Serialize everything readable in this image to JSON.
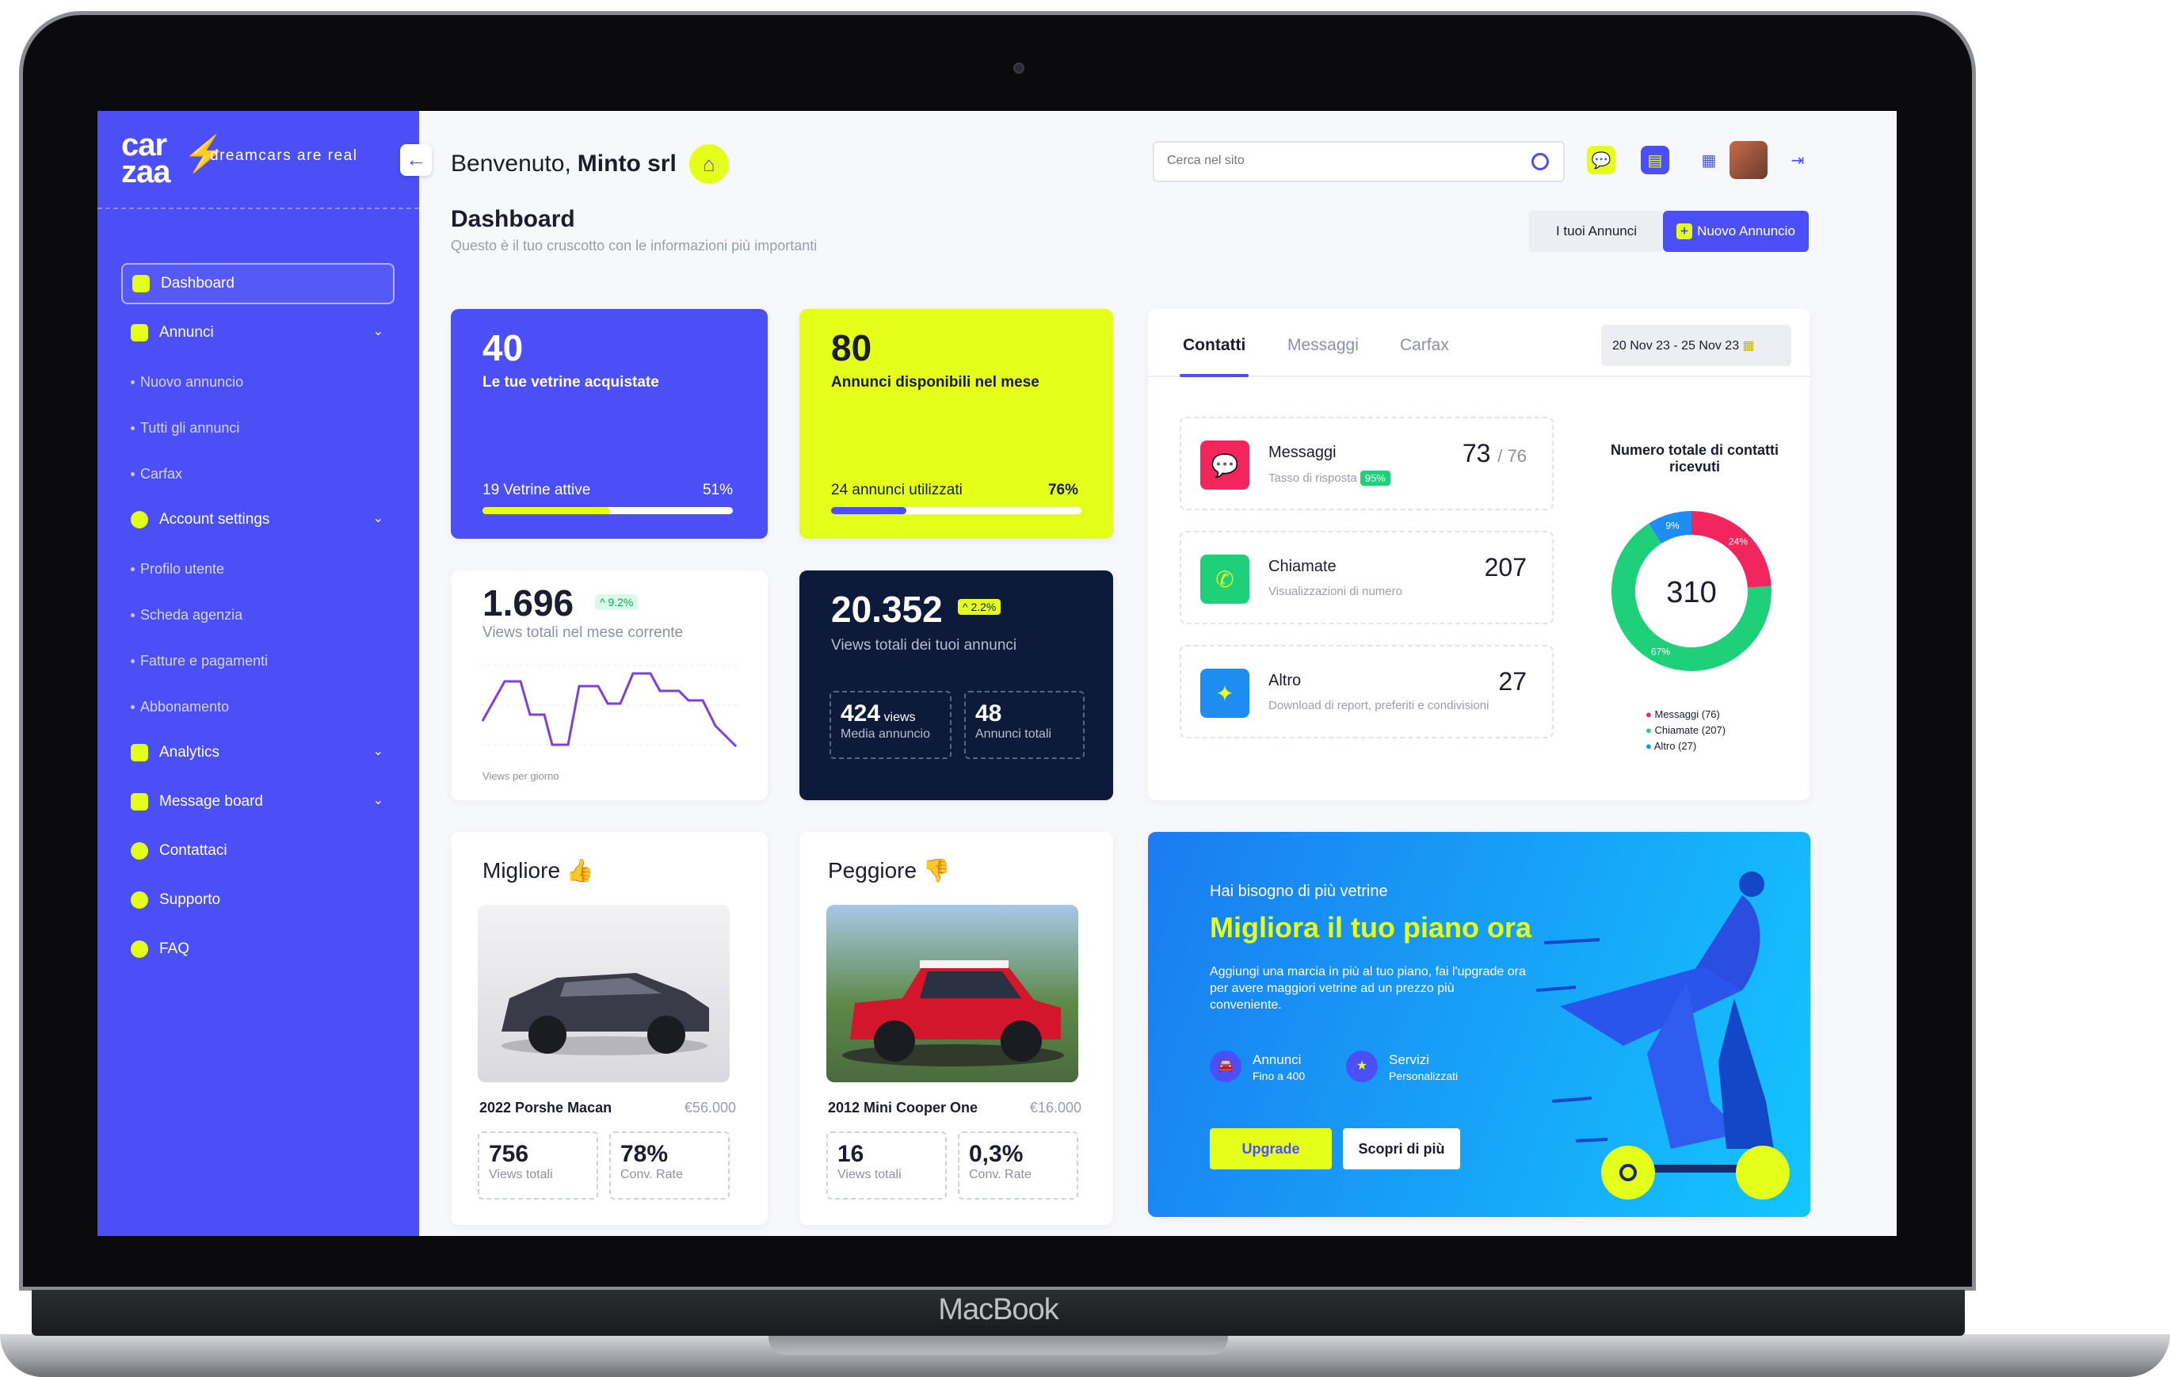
{
  "device": {
    "brand": "MacBook"
  },
  "sidebar": {
    "logo_line1": "car",
    "logo_line2": "zaa",
    "tagline": "dreamcars are real",
    "items": [
      {
        "label": "Dashboard"
      },
      {
        "label": "Annunci"
      },
      {
        "label": "Nuovo annuncio"
      },
      {
        "label": "Tutti gli annunci"
      },
      {
        "label": "Carfax"
      },
      {
        "label": "Account settings"
      },
      {
        "label": "Profilo utente"
      },
      {
        "label": "Scheda agenzia"
      },
      {
        "label": "Fatture e pagamenti"
      },
      {
        "label": "Abbonamento"
      },
      {
        "label": "Analytics"
      },
      {
        "label": "Message board"
      },
      {
        "label": "Contattaci"
      },
      {
        "label": "Supporto"
      },
      {
        "label": "FAQ"
      }
    ]
  },
  "header": {
    "welcome": "Benvenuto,",
    "company": "Minto srl",
    "search_placeholder": "Cerca nel sito"
  },
  "page": {
    "title": "Dashboard",
    "subtitle": "Questo è il tuo cruscotto con le informazioni più importanti",
    "btn_ads": "I tuoi Annunci",
    "btn_new": "Nuovo Annuncio"
  },
  "cards": {
    "vetrine": {
      "value": "40",
      "label": "Le tue vetrine acquistate",
      "foot": "19 Vetrine attive",
      "pct": "51%",
      "fill": 0.51
    },
    "annunci": {
      "value": "80",
      "label": "Annunci disponibili nel mese",
      "foot": "24 annunci utilizzati",
      "pct": "76%",
      "fill": 0.3
    },
    "views": {
      "value": "1.696",
      "delta": "^ 9.2%",
      "label": "Views totali nel mese corrente",
      "axis": "Views per giorno"
    },
    "total": {
      "value": "20.352",
      "delta": "^ 2.2%",
      "label": "Views totali dei tuoi annunci",
      "s1v": "424",
      "s1u": "views",
      "s1l": "Media annuncio",
      "s2v": "48",
      "s2l": "Annunci totali"
    }
  },
  "contacts": {
    "tabs": [
      "Contatti",
      "Messaggi",
      "Carfax"
    ],
    "date": "20 Nov 23 - 25 Nov 23",
    "rows": [
      {
        "title": "Messaggi",
        "sub": "Tasso di risposta",
        "badge": "95%",
        "num": "73",
        "den": "/ 76"
      },
      {
        "title": "Chiamate",
        "sub": "Visualizzazioni di numero",
        "num": "207"
      },
      {
        "title": "Altro",
        "sub": "Download di report, preferiti e condivisioni",
        "num": "27"
      }
    ],
    "donut_title": "Numero totale di contatti ricevuti",
    "total": "310",
    "slices": [
      {
        "label": "24%",
        "value": 24,
        "color": "#f2265d"
      },
      {
        "label": "67%",
        "value": 67,
        "color": "#1fd07a"
      },
      {
        "label": "9%",
        "value": 9,
        "color": "#1e8df2"
      }
    ],
    "legend": [
      "Messaggi (76)",
      "Chiamate (207)",
      "Altro (27)"
    ]
  },
  "best": {
    "title": "Migliore",
    "car": "2022 Porshe Macan",
    "price": "€56.000",
    "v1": "756",
    "l1": "Views totali",
    "v2": "78%",
    "l2": "Conv. Rate"
  },
  "worst": {
    "title": "Peggiore",
    "car": "2012 Mini Cooper One",
    "price": "€16.000",
    "v1": "16",
    "l1": "Views totali",
    "v2": "0,3%",
    "l2": "Conv. Rate"
  },
  "promo": {
    "kicker": "Hai bisogno di più vetrine",
    "title": "Migliora il tuo piano ora",
    "text": "Aggiungi una marcia in più al tuo piano, fai l'upgrade ora per avere maggiori vetrine ad un prezzo più conveniente.",
    "f1": "Annunci",
    "f1s": "Fino a 400",
    "f2": "Servizi",
    "f2s": "Personalizzati",
    "upgrade": "Upgrade",
    "more": "Scopri di più"
  }
}
